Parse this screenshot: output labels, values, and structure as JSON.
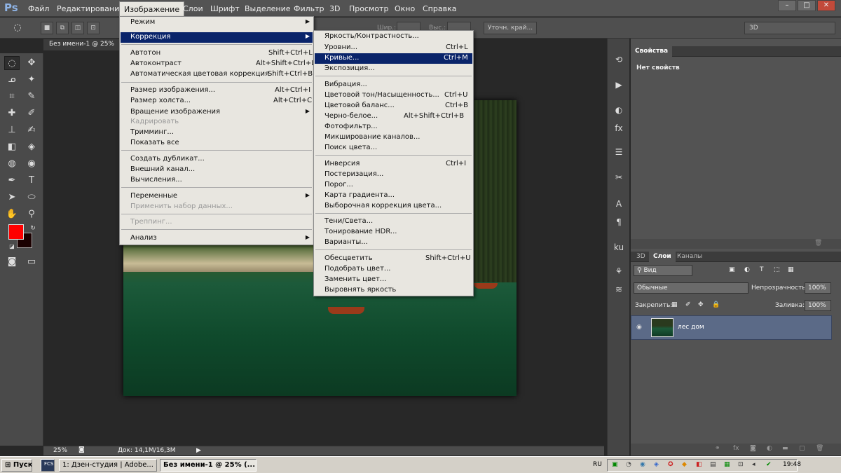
{
  "app_logo": "Ps",
  "menubar": {
    "items": [
      "Файл",
      "Редактирование",
      "Изображение",
      "Слои",
      "Шрифт",
      "Выделение",
      "Фильтр",
      "3D",
      "Просмотр",
      "Окно",
      "Справка"
    ],
    "open": "Изображение"
  },
  "window_buttons": [
    "–",
    "□",
    "✕"
  ],
  "options": {
    "width_label": "Шир.:",
    "height_label": "Выс.:",
    "refine_edge": "Уточн. край...",
    "workspace": "3D"
  },
  "document": {
    "tab_title": "Без имени-1 @ 25%",
    "zoom": "25%",
    "doc_size": "Док: 14,1M/16,3M"
  },
  "image_menu": {
    "items": [
      {
        "label": "Режим",
        "submenu": true
      },
      {
        "label": "Коррекция",
        "submenu": true,
        "highlighted": true
      },
      {
        "label": "Автотон",
        "shortcut": "Shift+Ctrl+L"
      },
      {
        "label": "Автоконтраст",
        "shortcut": "Alt+Shift+Ctrl+L"
      },
      {
        "label": "Автоматическая цветовая коррекция",
        "shortcut": "Shift+Ctrl+B"
      },
      {
        "label": "Размер изображения...",
        "shortcut": "Alt+Ctrl+I"
      },
      {
        "label": "Размер холста...",
        "shortcut": "Alt+Ctrl+C"
      },
      {
        "label": "Вращение изображения",
        "submenu": true
      },
      {
        "label": "Кадрировать",
        "disabled": true
      },
      {
        "label": "Тримминг..."
      },
      {
        "label": "Показать все"
      },
      {
        "label": "Создать дубликат..."
      },
      {
        "label": "Внешний канал..."
      },
      {
        "label": "Вычисления..."
      },
      {
        "label": "Переменные",
        "submenu": true
      },
      {
        "label": "Применить набор данных...",
        "disabled": true
      },
      {
        "label": "Треппинг...",
        "disabled": true
      },
      {
        "label": "Анализ",
        "submenu": true
      }
    ]
  },
  "correction_menu": {
    "items": [
      {
        "label": "Яркость/Контрастность..."
      },
      {
        "label": "Уровни...",
        "shortcut": "Ctrl+L"
      },
      {
        "label": "Кривые...",
        "shortcut": "Ctrl+M",
        "highlighted": true
      },
      {
        "label": "Экспозиция..."
      },
      {
        "label": "Вибрация..."
      },
      {
        "label": "Цветовой тон/Насыщенность...",
        "shortcut": "Ctrl+U"
      },
      {
        "label": "Цветовой баланс...",
        "shortcut": "Ctrl+B"
      },
      {
        "label": "Черно-белое...",
        "shortcut": "Alt+Shift+Ctrl+B"
      },
      {
        "label": "Фотофильтр..."
      },
      {
        "label": "Микширование каналов..."
      },
      {
        "label": "Поиск цвета..."
      },
      {
        "label": "Инверсия",
        "shortcut": "Ctrl+I"
      },
      {
        "label": "Постеризация..."
      },
      {
        "label": "Порог..."
      },
      {
        "label": "Карта градиента..."
      },
      {
        "label": "Выборочная коррекция цвета..."
      },
      {
        "label": "Тени/Света..."
      },
      {
        "label": "Тонирование HDR..."
      },
      {
        "label": "Варианты..."
      },
      {
        "label": "Обесцветить",
        "shortcut": "Shift+Ctrl+U"
      },
      {
        "label": "Подобрать цвет..."
      },
      {
        "label": "Заменить цвет..."
      },
      {
        "label": "Выровнять яркость"
      }
    ]
  },
  "properties_panel": {
    "tab": "Свойства",
    "empty_text": "Нет свойств"
  },
  "layers_panel": {
    "tabs": [
      "3D",
      "Слои",
      "Каналы"
    ],
    "active_tab": "Слои",
    "filter": "Вид",
    "blend_mode": "Обычные",
    "opacity_label": "Непрозрачность:",
    "opacity": "100%",
    "lock_label": "Закрепить:",
    "fill_label": "Заливка:",
    "fill": "100%",
    "layers": [
      {
        "name": "лес дом",
        "visible": true
      }
    ]
  },
  "taskbar": {
    "start": "Пуск",
    "tasks": [
      "1: Дзен-студия | Adobe...",
      "Без имени-1 @ 25% (..."
    ],
    "lang": "RU",
    "time": "19:48"
  },
  "colors": {
    "foreground": "#ff0000",
    "background": "#1a0000",
    "highlight": "#0a246a"
  }
}
